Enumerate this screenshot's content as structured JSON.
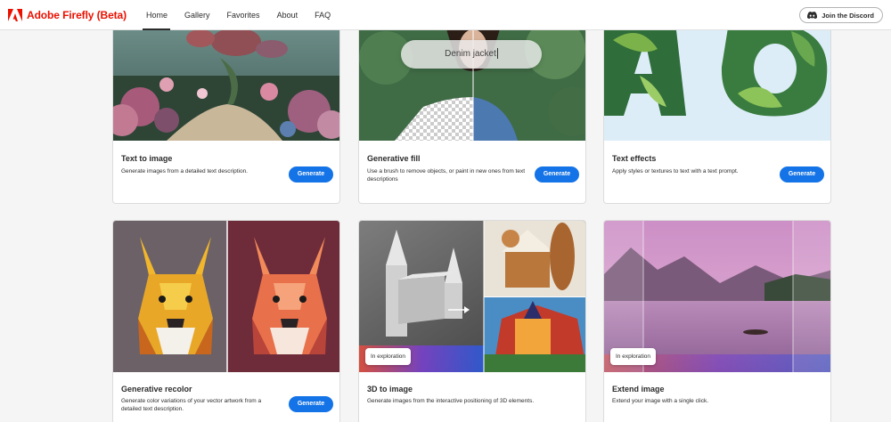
{
  "app": {
    "brand_name": "Adobe Firefly (Beta)"
  },
  "nav": {
    "items": [
      {
        "label": "Home",
        "active": true
      },
      {
        "label": "Gallery"
      },
      {
        "label": "Favorites"
      },
      {
        "label": "About"
      },
      {
        "label": "FAQ"
      }
    ]
  },
  "header": {
    "discord_label": "Join the Discord"
  },
  "colors": {
    "brand": "#eb1000",
    "accent": "#1473e6"
  },
  "cards": [
    {
      "title": "Text to image",
      "description": "Generate images from a detailed text description.",
      "button": "Generate"
    },
    {
      "title": "Generative fill",
      "description": "Use a brush to remove objects, or paint in new ones from text descriptions",
      "button": "Generate",
      "overlay_text": "Denim jacket"
    },
    {
      "title": "Text effects",
      "description": "Apply styles or textures to text with a text prompt.",
      "button": "Generate"
    },
    {
      "title": "Generative recolor",
      "description": "Generate color variations of your vector artwork from a detailed text description.",
      "button": "Generate"
    },
    {
      "title": "3D to image",
      "description": "Generate images from the interactive positioning of 3D elements.",
      "badge": "In exploration"
    },
    {
      "title": "Extend image",
      "description": "Extend your image with a single click.",
      "badge": "In exploration"
    }
  ]
}
